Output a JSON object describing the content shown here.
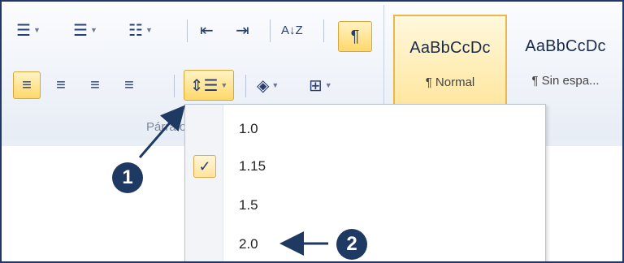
{
  "toolbar": {
    "bullets_icon": "bullets-icon",
    "numbering_icon": "numbering-icon",
    "multilevel_icon": "multilevel-list-icon",
    "decrease_indent_icon": "decrease-indent-icon",
    "increase_indent_icon": "increase-indent-icon",
    "sort_label": "A↓Z",
    "pilcrow": "¶",
    "line_spacing_icon": "line-spacing-icon",
    "shading_icon": "shading-icon",
    "borders_icon": "borders-icon"
  },
  "group": {
    "label": "Párrafo"
  },
  "styles": {
    "normal": {
      "sample": "AaBbCcDc",
      "name": "¶ Normal"
    },
    "no_spacing": {
      "sample": "AaBbCcDc",
      "name": "¶ Sin espa..."
    }
  },
  "menu": {
    "items": [
      {
        "label": "1.0",
        "checked": false
      },
      {
        "label": "1.15",
        "checked": true
      },
      {
        "label": "1.5",
        "checked": false
      },
      {
        "label": "2.0",
        "checked": false
      }
    ],
    "check_mark": "✓"
  },
  "callouts": {
    "one": "1",
    "two": "2"
  },
  "colors": {
    "accent": "#1f3a62",
    "highlight": "#ffd86a"
  }
}
